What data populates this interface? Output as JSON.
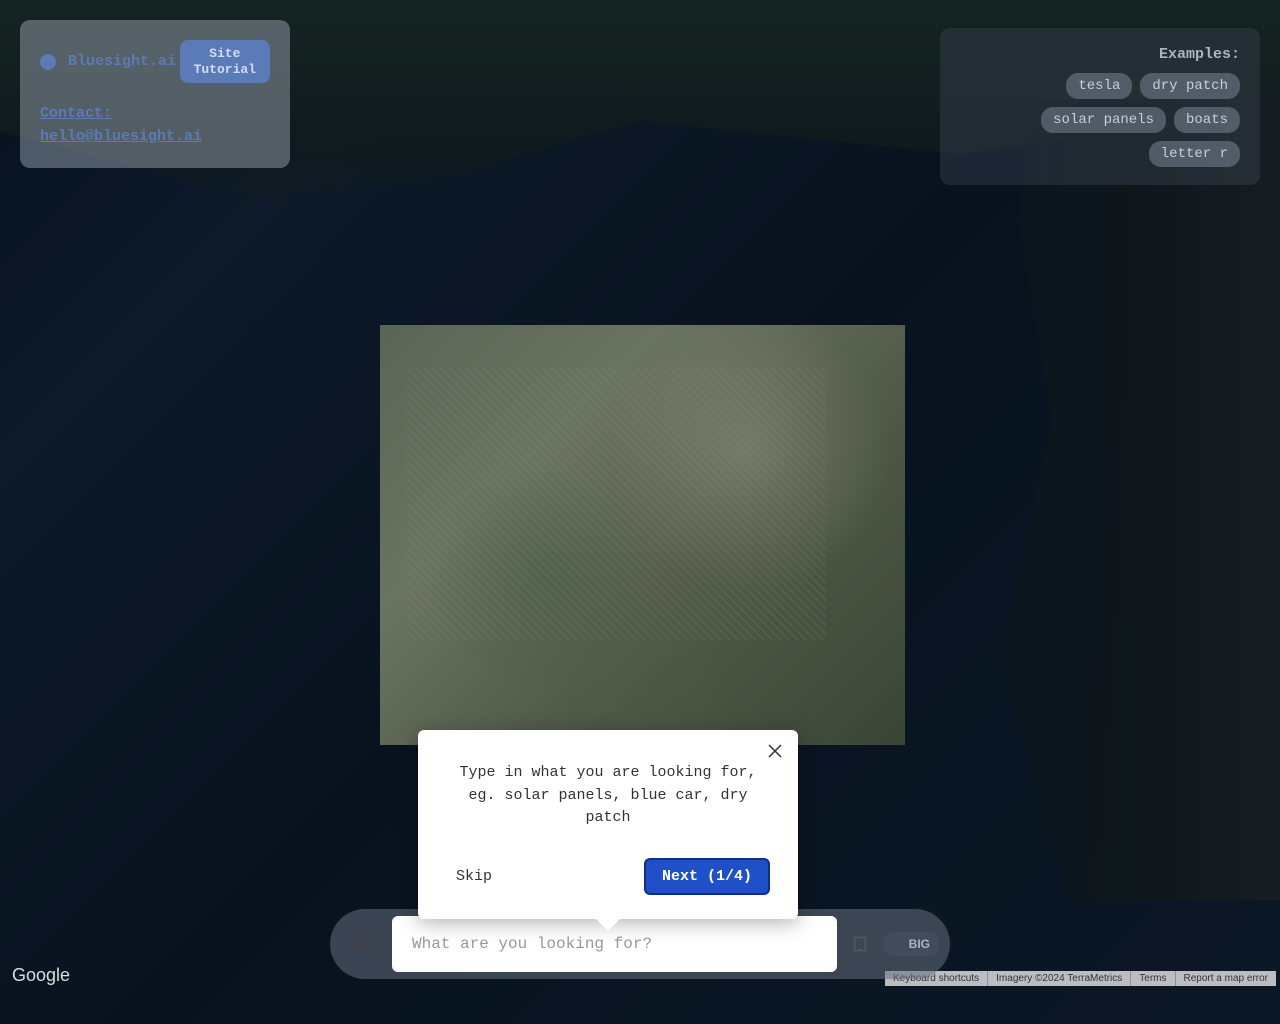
{
  "brand": {
    "name": "Bluesight.ai",
    "tutorial_button": "Site\nTutorial",
    "contact_label": "Contact:",
    "contact_email": "hello@bluesight.ai"
  },
  "examples": {
    "label": "Examples:",
    "chips": [
      "tesla",
      "dry patch",
      "solar panels",
      "boats",
      "letter r"
    ]
  },
  "tutorial_popup": {
    "message": "Type in what you are looking for, eg. solar panels, blue car, dry patch",
    "skip_label": "Skip",
    "next_label": "Next (1/4)"
  },
  "search": {
    "placeholder": "What are you looking for?",
    "big_label": "BIG"
  },
  "attribution": {
    "google_logo": "Google",
    "items": [
      "Keyboard shortcuts",
      "Imagery ©2024 TerraMetrics",
      "Terms",
      "Report a map error"
    ]
  }
}
